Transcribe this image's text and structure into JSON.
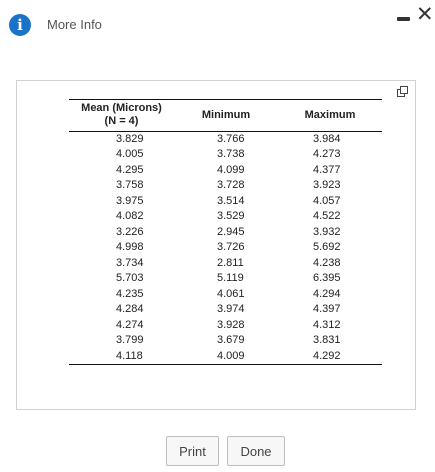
{
  "dialog": {
    "title": "More Info",
    "info_icon": "i",
    "close_glyph": "✕"
  },
  "table": {
    "headers": [
      "Mean (Microns)\n(N = 4)",
      "Minimum",
      "Maximum"
    ],
    "rows": [
      [
        "3.829",
        "3.766",
        "3.984"
      ],
      [
        "4.005",
        "3.738",
        "4.273"
      ],
      [
        "4.295",
        "4.099",
        "4.377"
      ],
      [
        "3.758",
        "3.728",
        "3.923"
      ],
      [
        "3.975",
        "3.514",
        "4.057"
      ],
      [
        "4.082",
        "3.529",
        "4.522"
      ],
      [
        "3.226",
        "2.945",
        "3.932"
      ],
      [
        "4.998",
        "3.726",
        "5.692"
      ],
      [
        "3.734",
        "2.811",
        "4.238"
      ],
      [
        "5.703",
        "5.119",
        "6.395"
      ],
      [
        "4.235",
        "4.061",
        "4.294"
      ],
      [
        "4.284",
        "3.974",
        "4.397"
      ],
      [
        "4.274",
        "3.928",
        "4.312"
      ],
      [
        "3.799",
        "3.679",
        "3.831"
      ],
      [
        "4.118",
        "4.009",
        "4.292"
      ]
    ]
  },
  "buttons": {
    "print": "Print",
    "done": "Done"
  },
  "icons": {
    "info": "info-icon",
    "minimize": "minimize-icon",
    "close": "close-icon",
    "copy": "copy-icon"
  },
  "colors": {
    "info_icon_bg": "#1a73c9",
    "panel_border": "#d2d2d2"
  }
}
